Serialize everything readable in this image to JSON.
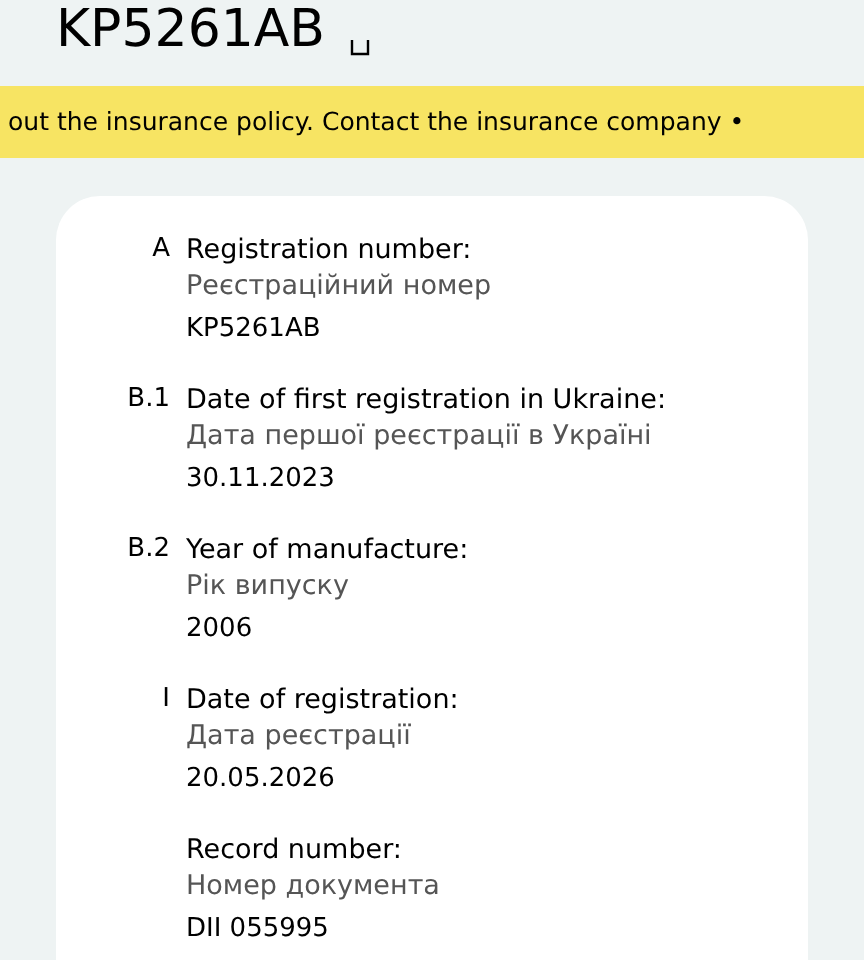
{
  "header": {
    "title": "KP5261AB"
  },
  "banner": {
    "text": "out the insurance policy. Contact the insurance company •"
  },
  "fields": [
    {
      "code": "A",
      "label": "Registration number:",
      "label_uk": "Реєстраційний номер",
      "value": "KP5261AB"
    },
    {
      "code": "B.1",
      "label": "Date of first registration in Ukraine:",
      "label_uk": "Дата першої реєстрації в Україні",
      "value": "30.11.2023"
    },
    {
      "code": "B.2",
      "label": "Year of manufacture:",
      "label_uk": "Рік випуску",
      "value": "2006"
    },
    {
      "code": "I",
      "label": "Date of registration:",
      "label_uk": "Дата реєстрації",
      "value": "20.05.2026"
    },
    {
      "label": "Record number:",
      "label_uk": "Номер документа",
      "value": "DII 055995"
    }
  ]
}
